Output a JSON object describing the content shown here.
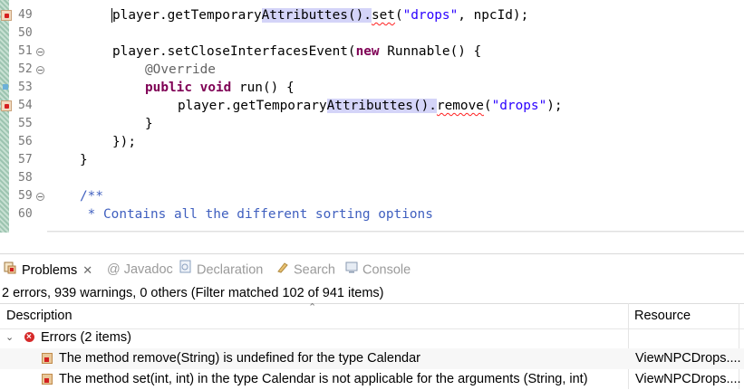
{
  "editor": {
    "lines": [
      {
        "num": "49",
        "html_segments": "l49"
      },
      {
        "num": "50"
      },
      {
        "num": "51"
      },
      {
        "num": "52"
      },
      {
        "num": "53"
      },
      {
        "num": "54"
      },
      {
        "num": "55"
      },
      {
        "num": "56"
      },
      {
        "num": "57"
      },
      {
        "num": "58"
      },
      {
        "num": "59"
      },
      {
        "num": "60"
      }
    ],
    "code": {
      "l49_a": "player.getTemporary",
      "l49_b": "Attributtes",
      "l49_c": "().",
      "l49_d": "set",
      "l49_e": "(",
      "l49_f": "\"drops\"",
      "l49_g": ", npcId);",
      "l51_a": "player.setCloseInterfacesEvent(",
      "l51_kw": "new",
      "l51_b": " Runnable() {",
      "l52": "@Override",
      "l53_kw1": "public",
      "l53_kw2": "void",
      "l53_b": " run() {",
      "l54_a": "player.getTemporary",
      "l54_b": "Attributtes",
      "l54_c": "().",
      "l54_d": "remove",
      "l54_e": "(",
      "l54_f": "\"drops\"",
      "l54_g": ");",
      "l55": "}",
      "l56": "});",
      "l57": "}",
      "l59": "/**",
      "l60": " * Contains all the different sorting options"
    },
    "scroll_left_arrow": "<"
  },
  "problems_view": {
    "tabs": [
      {
        "label": "Problems",
        "icon": "problems-icon"
      },
      {
        "label": "@ Javadoc",
        "icon": "javadoc-icon"
      },
      {
        "label": "Declaration",
        "icon": "declaration-icon"
      },
      {
        "label": "Search",
        "icon": "search-icon"
      },
      {
        "label": "Console",
        "icon": "console-icon"
      }
    ],
    "close_glyph": "✕",
    "summary": "2 errors, 939 warnings, 0 others (Filter matched 102 of 941 items)",
    "columns": {
      "description": "Description",
      "resource": "Resource"
    },
    "group": {
      "label": "Errors (2 items)",
      "expanded_glyph": "⌄"
    },
    "rows": [
      {
        "description": "The method remove(String) is undefined for the type Calendar",
        "resource": "ViewNPCDrops...."
      },
      {
        "description": "The method set(int, int) in the type Calendar is not applicable for the arguments (String, int)",
        "resource": "ViewNPCDrops...."
      }
    ]
  },
  "colors": {
    "keyword": "#7f0055",
    "string": "#2a00ff",
    "javadoc": "#3f5fbf",
    "error": "#d62020"
  }
}
